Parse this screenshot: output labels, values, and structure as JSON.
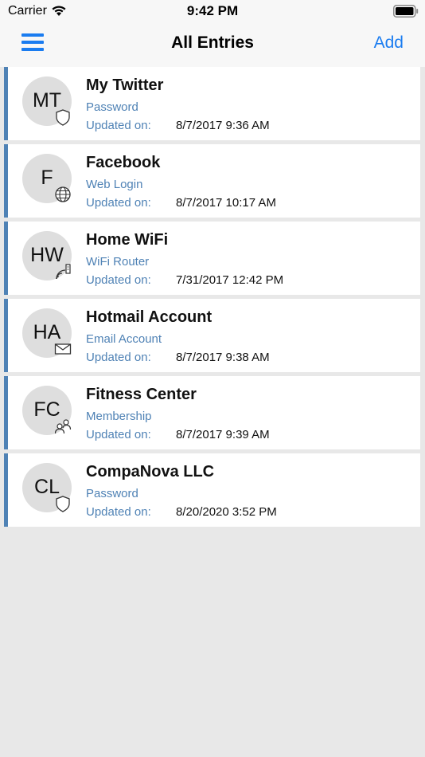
{
  "status_bar": {
    "carrier": "Carrier",
    "time": "9:42 PM",
    "wifi_icon": "wifi-icon",
    "battery_icon": "battery-icon"
  },
  "nav": {
    "menu_icon": "hamburger-menu-icon",
    "title": "All Entries",
    "add_label": "Add"
  },
  "colors": {
    "accent": "#1a7cf0",
    "entry_stripe": "#4f82b5",
    "subtitle_text": "#4f82b5",
    "background": "#e8e8e8"
  },
  "entries": [
    {
      "initials": "MT",
      "name": "My Twitter",
      "type": "Password",
      "updated_label": "Updated on:",
      "updated": "8/7/2017 9:36 AM",
      "icon": "shield-icon"
    },
    {
      "initials": "F",
      "name": "Facebook",
      "type": "Web Login",
      "updated_label": "Updated on:",
      "updated": "8/7/2017 10:17 AM",
      "icon": "globe-icon"
    },
    {
      "initials": "HW",
      "name": "Home WiFi",
      "type": "WiFi Router",
      "updated_label": "Updated on:",
      "updated": "7/31/2017 12:42 PM",
      "icon": "router-icon"
    },
    {
      "initials": "HA",
      "name": "Hotmail Account",
      "type": "Email Account",
      "updated_label": "Updated on:",
      "updated": "8/7/2017 9:38 AM",
      "icon": "envelope-icon"
    },
    {
      "initials": "FC",
      "name": "Fitness Center",
      "type": "Membership",
      "updated_label": "Updated on:",
      "updated": "8/7/2017 9:39 AM",
      "icon": "people-icon"
    },
    {
      "initials": "CL",
      "name": "CompaNova LLC",
      "type": "Password",
      "updated_label": "Updated on:",
      "updated": "8/20/2020 3:52 PM",
      "icon": "shield-icon"
    }
  ]
}
